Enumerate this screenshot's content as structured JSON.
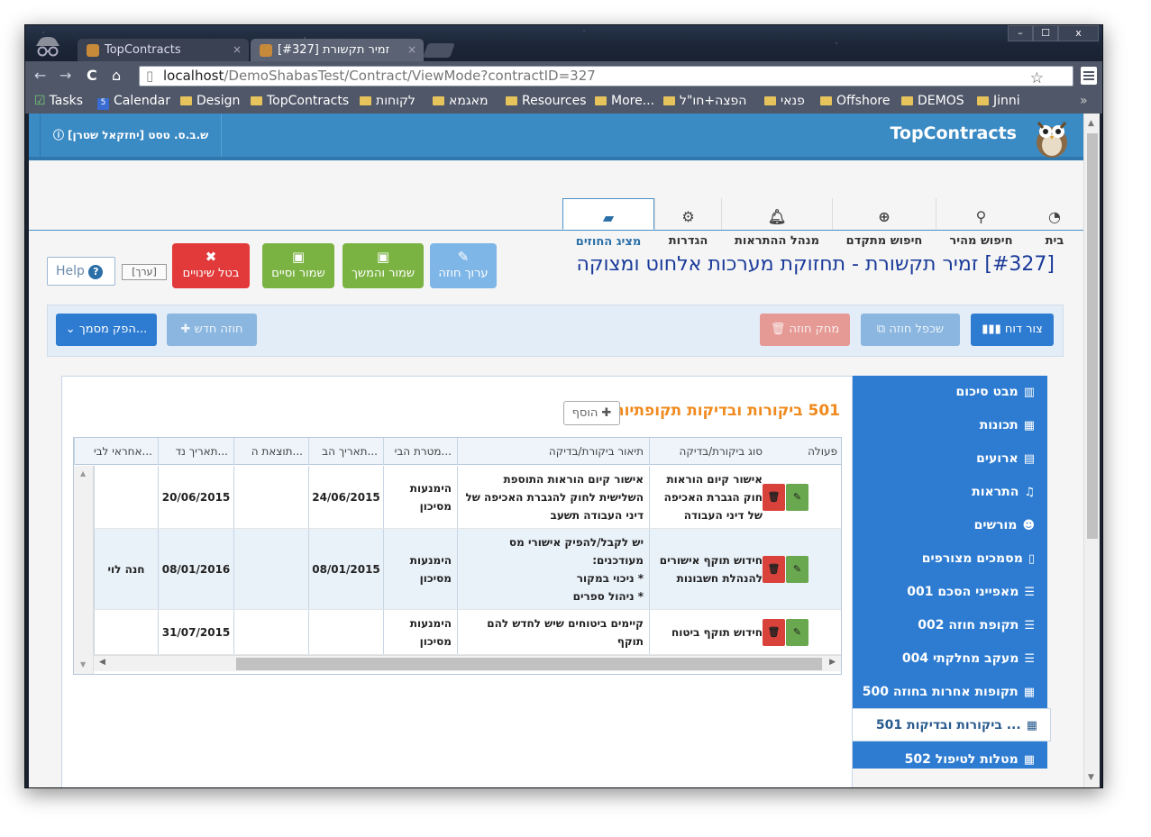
{
  "browser": {
    "tabs": [
      {
        "title": "TopContracts",
        "close": "×"
      },
      {
        "title": "[#327] זמיר תקשורת",
        "close": "×"
      }
    ],
    "window_controls": {
      "minimize": "–",
      "maximize": "☐",
      "close": "x"
    },
    "url_host": "localhost",
    "url_path": "/DemoShabasTest/Contract/ViewMode?contractID=327",
    "bookmarks": [
      "Tasks",
      "Calendar",
      "Design",
      "TopContracts",
      "לקוחות",
      "מאגמא",
      "Resources",
      "More...",
      "הפצה+חו\"ל",
      "פנאי",
      "Offshore",
      "DEMOS",
      "Jinni"
    ],
    "bookmarks_overflow": "»"
  },
  "app": {
    "brand": "TopContracts",
    "user": "ש.ב.ס. טסט [יחזקאל שטרן]",
    "nav": [
      {
        "label": "בית",
        "icon": "dashboard-icon"
      },
      {
        "label": "חיפוש מהיר",
        "icon": "search-icon"
      },
      {
        "label": "חיפוש מתקדם",
        "icon": "zoom-in-icon"
      },
      {
        "label": "מנהל ההתראות",
        "icon": "bell-icon"
      },
      {
        "label": "הגדרות",
        "icon": "gear-icon"
      },
      {
        "label": "מציג החוזים",
        "icon": "book-icon"
      }
    ],
    "page_title": "[#327] זמיר תקשורת - תחזוקת מערכות אלחוט ומצוקה",
    "actions": {
      "edit": "ערוך חוזה",
      "save_continue": "שמור והמשך",
      "save_finish": "שמור וסיים",
      "cancel": "בטל שינויים",
      "edit_tag": "[ערך]",
      "help": "Help"
    },
    "toolbar": {
      "report": "צור דוח",
      "duplicate": "שכפל חוזה",
      "delete": "מחק חוזה",
      "new": "חוזה חדש",
      "produce_doc": "הפק מסמך..."
    },
    "sidebar": [
      "מבט סיכום",
      "תכונות",
      "ארועים",
      "התראות",
      "מורשים",
      "מסמכים מצורפים",
      "001 מאפייני הסכם",
      "002 תקופת חוזה",
      "004 מעקב מחלקתי",
      "500 תקופות אחרות בחוזה",
      "501 ביקורות ובדיקות ...",
      "502 מטלות לטיפול"
    ],
    "section": {
      "title": "501 ביקורות ובדיקות תקופתיות",
      "add": "הוסף"
    },
    "table": {
      "columns": [
        "פעולה",
        "סוג ביקורת/בדיקה",
        "תיאור ביקורת/בדיקה",
        "מטרת הבי...",
        "תאריך הב...",
        "תוצאת ה...",
        "תאריך נד...",
        "אחראי לבי..."
      ],
      "rows": [
        {
          "type": "אישור קיום הוראות חוק הגברת האכיפה של דיני העבודה",
          "description": [
            "אישור קיום הוראות התוספת",
            "השלישית לחוק להגברת האכיפה של",
            "דיני העבודה תשעב"
          ],
          "purpose": "הימנעות מסיכון",
          "check_date": "24/06/2015",
          "result": "",
          "next_date": "20/06/2015",
          "owner": ""
        },
        {
          "type": "חידוש תוקף אישורים להנהלת חשבונות",
          "description": [
            "יש לקבל/להפיק אישורי מס",
            "מעודכנים:",
            "* ניכוי במקור",
            "* ניהול ספרים"
          ],
          "purpose": "הימנעות מסיכון",
          "check_date": "08/01/2015",
          "result": "",
          "next_date": "08/01/2016",
          "owner": "חנה לוי"
        },
        {
          "type": "חידוש תוקף ביטוח",
          "description": [
            "קיימים ביטוחים שיש לחדש להם",
            "תוקף"
          ],
          "purpose": "הימנעות מסיכון",
          "check_date": "",
          "result": "",
          "next_date": "31/07/2015",
          "owner": ""
        }
      ]
    }
  }
}
